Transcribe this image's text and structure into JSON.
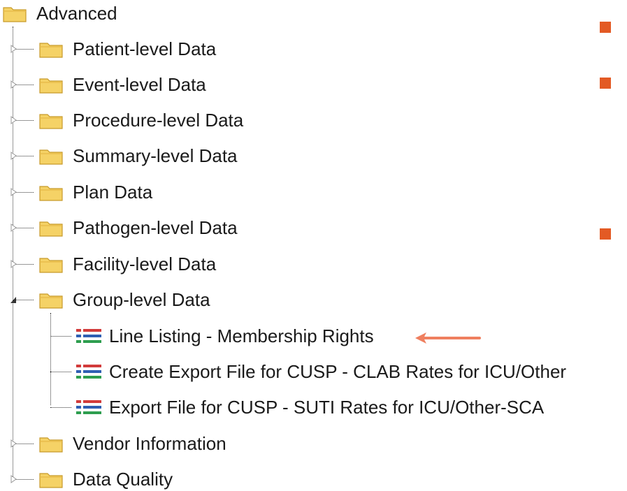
{
  "tree": {
    "root": {
      "label": "Advanced",
      "icon": "folder-icon"
    },
    "folders": [
      {
        "label": "Patient-level Data",
        "state": "collapsed"
      },
      {
        "label": "Event-level Data",
        "state": "collapsed"
      },
      {
        "label": "Procedure-level Data",
        "state": "collapsed"
      },
      {
        "label": "Summary-level Data",
        "state": "collapsed"
      },
      {
        "label": "Plan Data",
        "state": "collapsed"
      },
      {
        "label": "Pathogen-level Data",
        "state": "collapsed"
      },
      {
        "label": "Facility-level Data",
        "state": "collapsed"
      },
      {
        "label": "Group-level Data",
        "state": "expanded"
      },
      {
        "label": "Vendor Information",
        "state": "collapsed"
      },
      {
        "label": "Data Quality",
        "state": "collapsed"
      }
    ],
    "group_reports": [
      {
        "label": "Line Listing - Membership Rights",
        "icon": "line-listing-icon",
        "highlighted": true
      },
      {
        "label": "Create Export File for CUSP - CLAB Rates for ICU/Other",
        "icon": "line-listing-icon"
      },
      {
        "label": "Export File for CUSP - SUTI Rates for ICU/Other-SCA",
        "icon": "line-listing-icon"
      }
    ]
  },
  "colors": {
    "folder_fill": "#f5d266",
    "folder_edge": "#c79a2b",
    "marker": "#e35a24",
    "arrow": "#ef7f5f",
    "report_red": "#d23b3b",
    "report_blue": "#2f5fb3",
    "report_green": "#2e9e4f"
  }
}
